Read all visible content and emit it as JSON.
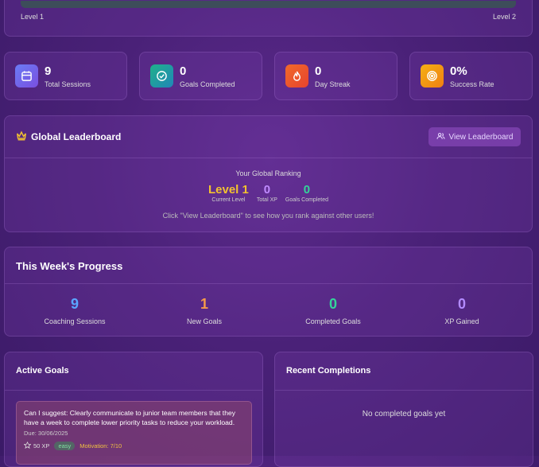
{
  "level": {
    "from": "Level 1",
    "to": "Level 2"
  },
  "stats": [
    {
      "value": "9",
      "label": "Total Sessions",
      "icon": "calendar-icon",
      "color": "#6a5cf0"
    },
    {
      "value": "0",
      "label": "Goals Completed",
      "icon": "check-circle-icon",
      "color": "#16a39a"
    },
    {
      "value": "0",
      "label": "Day Streak",
      "icon": "flame-icon",
      "color": "#ee5a2c"
    },
    {
      "value": "0%",
      "label": "Success Rate",
      "icon": "target-icon",
      "color": "#f29a12"
    }
  ],
  "leaderboard": {
    "title": "Global Leaderboard",
    "button": "View Leaderboard",
    "ranking_title": "Your Global Ranking",
    "items": [
      {
        "value": "Level 1",
        "label": "Current Level",
        "color": "#f2c230"
      },
      {
        "value": "0",
        "label": "Total XP",
        "color": "#c08bff"
      },
      {
        "value": "0",
        "label": "Goals Completed",
        "color": "#34d39a"
      }
    ],
    "note": "Click \"View Leaderboard\" to see how you rank against other users!"
  },
  "week": {
    "title": "This Week's Progress",
    "items": [
      {
        "value": "9",
        "label": "Coaching Sessions",
        "color": "#5aa6ff"
      },
      {
        "value": "1",
        "label": "New Goals",
        "color": "#f59a4a"
      },
      {
        "value": "0",
        "label": "Completed Goals",
        "color": "#34d39a"
      },
      {
        "value": "0",
        "label": "XP Gained",
        "color": "#b38bff"
      }
    ]
  },
  "active_goals": {
    "title": "Active Goals",
    "goal": {
      "text": "Can I suggest: Clearly communicate to junior team members that they have a week to complete lower priority tasks to reduce your workload.",
      "due": "Due: 30/06/2025",
      "xp": "50 XP",
      "difficulty": "easy",
      "motivation": "Motivation: 7/10"
    }
  },
  "recent": {
    "title": "Recent Completions",
    "empty": "No completed goals yet"
  }
}
